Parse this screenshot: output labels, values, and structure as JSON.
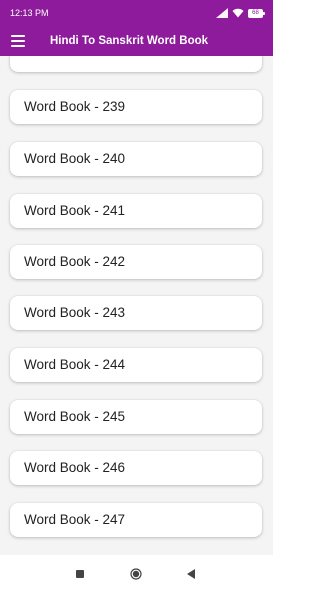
{
  "status_bar": {
    "time": "12:13 PM",
    "battery": "68"
  },
  "app_bar": {
    "title": "Hindi To Sanskrit Word Book",
    "menu_icon": "hamburger-menu-icon"
  },
  "list": {
    "items": [
      {
        "label": "Word Book - 239"
      },
      {
        "label": "Word Book - 240"
      },
      {
        "label": "Word Book - 241"
      },
      {
        "label": "Word Book - 242"
      },
      {
        "label": "Word Book - 243"
      },
      {
        "label": "Word Book - 244"
      },
      {
        "label": "Word Book - 245"
      },
      {
        "label": "Word Book - 246"
      },
      {
        "label": "Word Book - 247"
      }
    ]
  },
  "nav_bar": {
    "recents_icon": "square-recents-icon",
    "home_icon": "circle-home-icon",
    "back_icon": "triangle-back-icon"
  },
  "colors": {
    "primary": "#8e1a9c",
    "background": "#f4f4f4",
    "card": "#ffffff",
    "text": "#222222"
  }
}
